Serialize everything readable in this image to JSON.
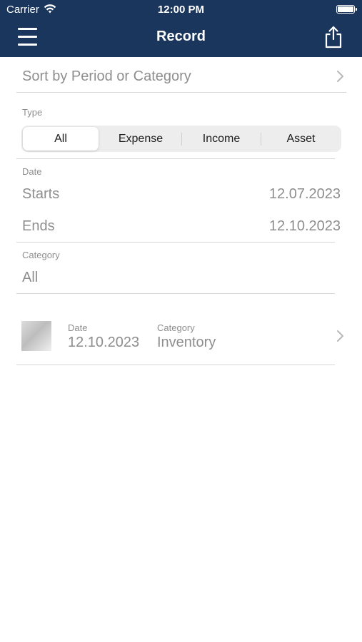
{
  "status_bar": {
    "carrier": "Carrier",
    "time": "12:00 PM"
  },
  "nav": {
    "title": "Record",
    "menu_icon": "hamburger-menu-icon",
    "share_icon": "share-icon"
  },
  "sort": {
    "label": "Sort by Period or Category"
  },
  "type": {
    "label": "Type",
    "options": [
      "All",
      "Expense",
      "Income",
      "Asset"
    ],
    "selected": "All"
  },
  "date": {
    "label": "Date",
    "starts_label": "Starts",
    "starts_value": "12.07.2023",
    "ends_label": "Ends",
    "ends_value": "12.10.2023"
  },
  "category": {
    "label": "Category",
    "value": "All"
  },
  "records": [
    {
      "date_label": "Date",
      "date": "12.10.2023",
      "category_label": "Category",
      "category": "Inventory"
    }
  ],
  "colors": {
    "nav_bar": "#1b365d",
    "text_gray": "#8e8e8e",
    "segment_bg": "#ededed"
  }
}
